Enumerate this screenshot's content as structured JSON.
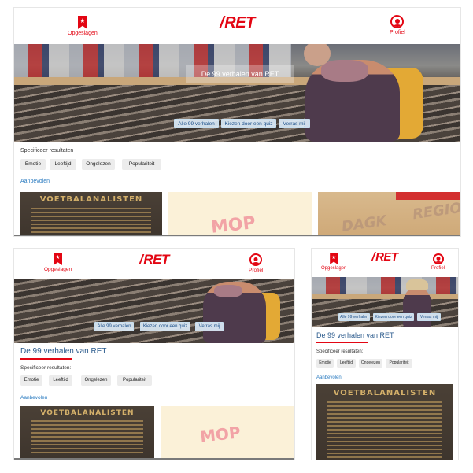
{
  "app": {
    "logo": "RET"
  },
  "header": {
    "saved_label": "Opgeslagen",
    "profile_label": "Profiel"
  },
  "hero": {
    "title": "De 99 verhalen van RET"
  },
  "buttons": {
    "all_stories": "Alle 99 verhalen",
    "quiz": "Kiezen door een quiz",
    "surprise": "Verras mij"
  },
  "filters": {
    "heading_wide": "Specificeer resultaten",
    "heading": "Specificeer resultaten:",
    "options": [
      "Emotie",
      "Leeftijd",
      "Ongelezen",
      "Populariteit"
    ]
  },
  "recommended": {
    "label": "Aanbevolen"
  },
  "cards": {
    "book_title": "VOETBALANALISTEN",
    "mop_text": "MOP",
    "ticket_text": "REGIO",
    "ticket_text_2": "DAGK"
  },
  "icons": {
    "saved": "bookmark-star-icon",
    "profile": "person-circle-icon"
  },
  "colors": {
    "brand_red": "#e30613",
    "title_blue": "#2a5a8c",
    "link_blue": "#2a7bc0"
  }
}
